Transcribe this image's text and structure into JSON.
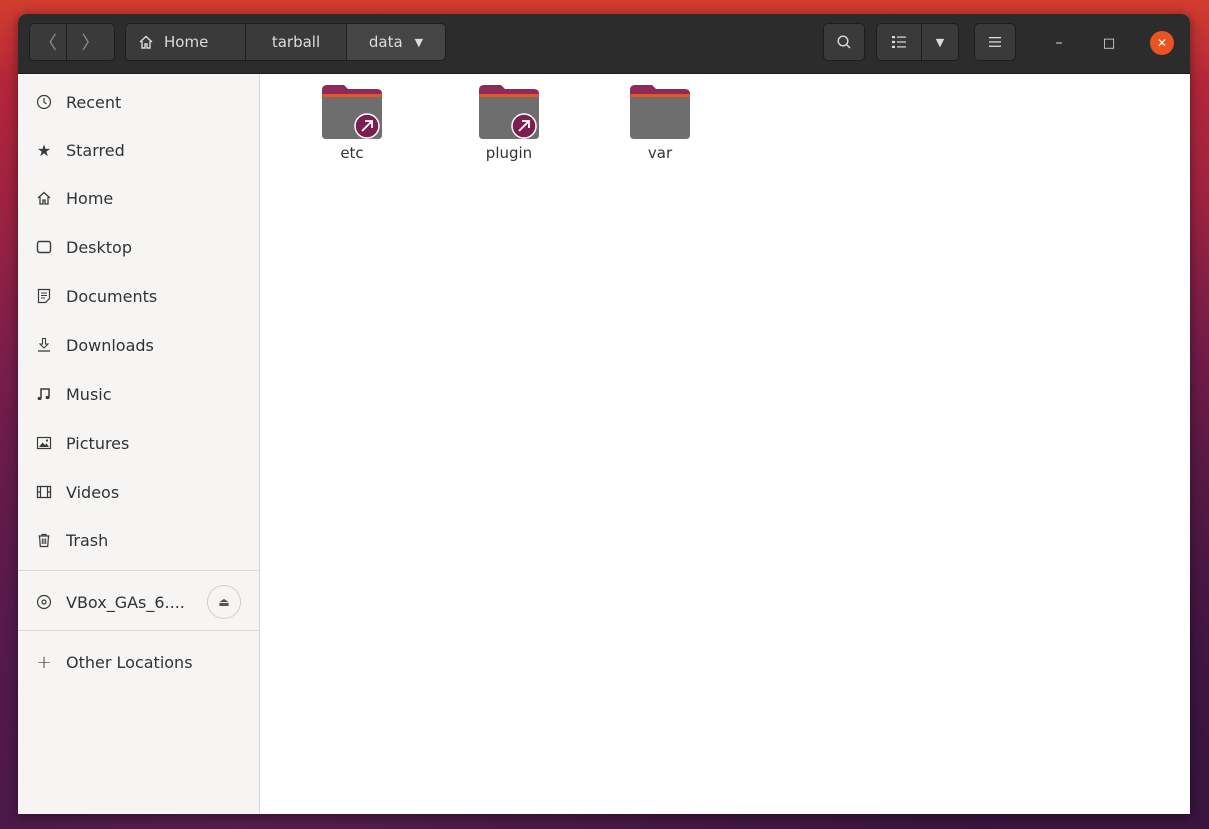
{
  "headerbar": {
    "back_glyph": "〈",
    "forward_glyph": "〉",
    "breadcrumbs": [
      {
        "label": "Home",
        "icon": "home-icon"
      },
      {
        "label": "tarball"
      },
      {
        "label": "data",
        "dropdown": true
      }
    ],
    "search_icon": "search-icon",
    "view_icon": "list-view-icon",
    "view_dropdown_icon": "chevron-down-icon",
    "menu_icon": "hamburger-menu-icon",
    "window_controls": {
      "minimize": "–",
      "maximize": "□",
      "close": "✕"
    },
    "accent_close": "#e95420"
  },
  "sidebar": {
    "items": [
      {
        "label": "Recent",
        "icon": "clock-icon"
      },
      {
        "label": "Starred",
        "icon": "star-icon"
      },
      {
        "label": "Home",
        "icon": "home-icon"
      },
      {
        "label": "Desktop",
        "icon": "desktop-icon"
      },
      {
        "label": "Documents",
        "icon": "document-icon"
      },
      {
        "label": "Downloads",
        "icon": "download-icon"
      },
      {
        "label": "Music",
        "icon": "music-icon"
      },
      {
        "label": "Pictures",
        "icon": "picture-icon"
      },
      {
        "label": "Videos",
        "icon": "video-icon"
      },
      {
        "label": "Trash",
        "icon": "trash-icon"
      }
    ],
    "device": {
      "label": "VBox_GAs_6....",
      "icon": "disc-icon",
      "eject_icon": "eject-icon"
    },
    "other_locations": {
      "label": "Other Locations",
      "icon": "plus-icon"
    }
  },
  "content": {
    "files": [
      {
        "name": "etc",
        "type": "folder",
        "symlink": true
      },
      {
        "name": "plugin",
        "type": "folder",
        "symlink": true
      },
      {
        "name": "var",
        "type": "folder",
        "symlink": false
      }
    ],
    "folder_colors": {
      "body": "#6e6e6e",
      "tab": "#8c2a5a",
      "link_badge": "#7a1f4f"
    }
  }
}
